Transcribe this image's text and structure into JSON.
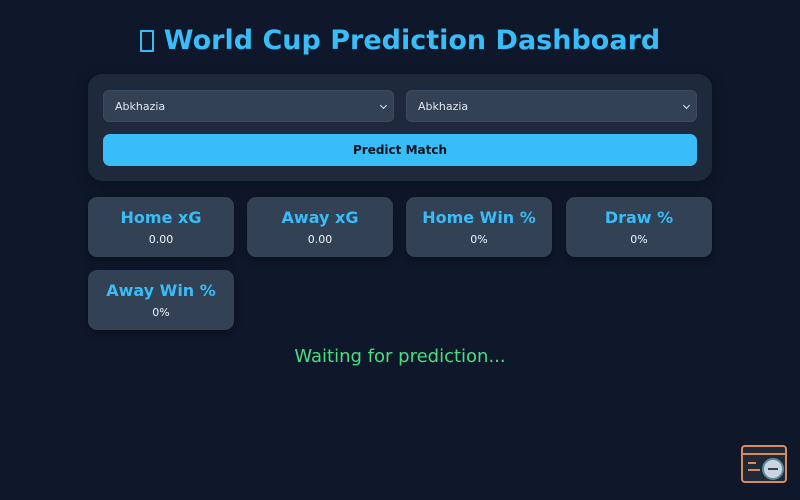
{
  "header": {
    "title": "World Cup Prediction Dashboard",
    "icon": "trophy-icon"
  },
  "form": {
    "home_team": "Abkhazia",
    "away_team": "Abkhazia",
    "predict_label": "Predict Match"
  },
  "stats": [
    {
      "label": "Home xG",
      "value": "0.00"
    },
    {
      "label": "Away xG",
      "value": "0.00"
    },
    {
      "label": "Home Win %",
      "value": "0%"
    },
    {
      "label": "Draw %",
      "value": "0%"
    },
    {
      "label": "Away Win %",
      "value": "0%"
    }
  ],
  "status": "Waiting for prediction...",
  "colors": {
    "background": "#0f172a",
    "card": "#1e293b",
    "stat_card": "#334155",
    "accent": "#38bdf8",
    "status": "#4ade80"
  }
}
